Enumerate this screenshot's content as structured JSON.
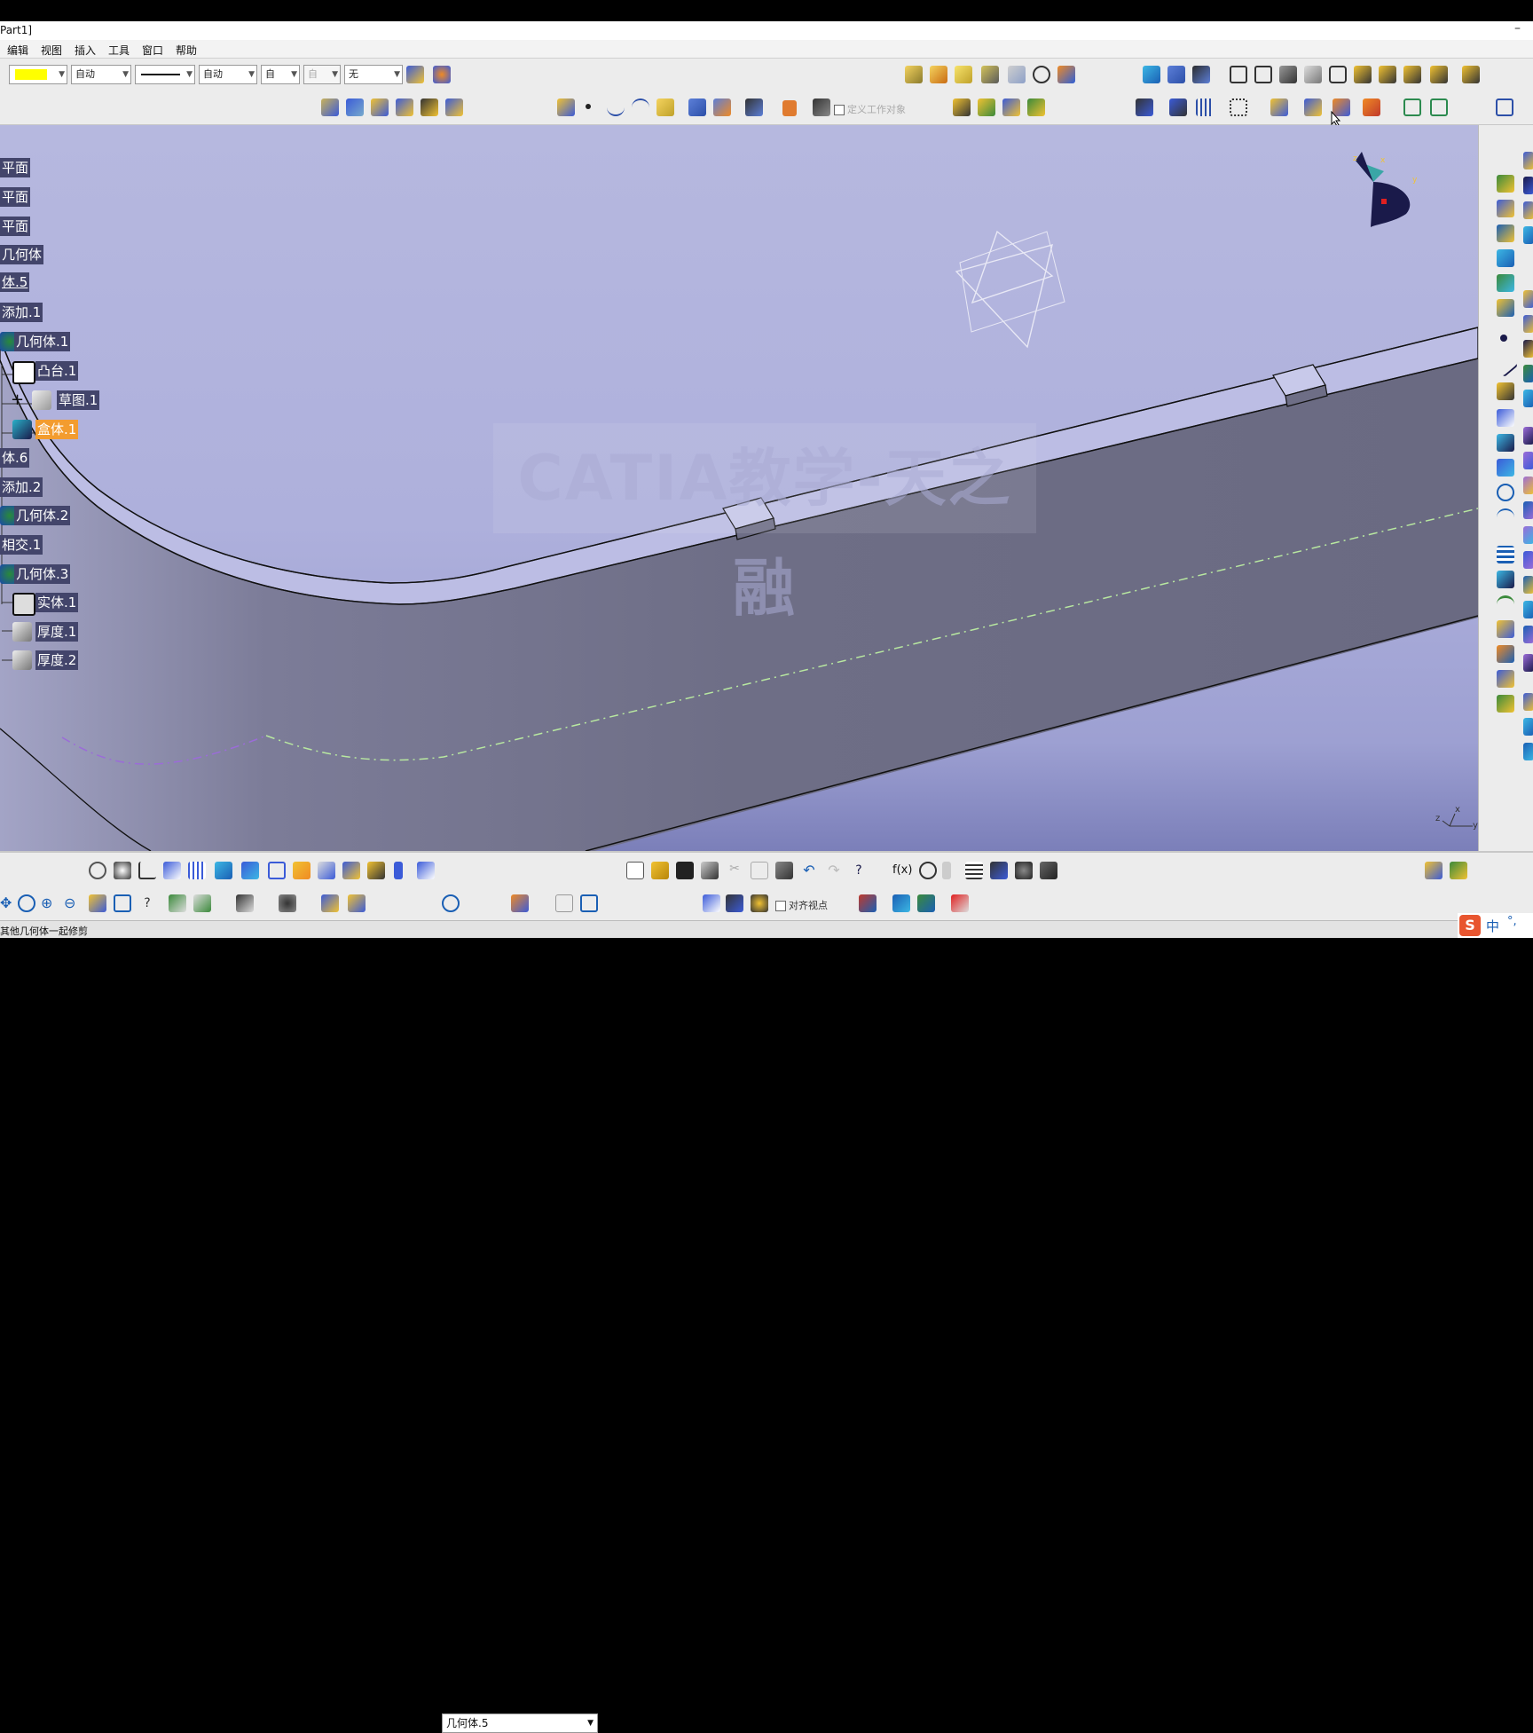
{
  "window": {
    "title": "Part1]",
    "minimize_glyph": "–"
  },
  "menu": {
    "items": [
      "编辑",
      "视图",
      "插入",
      "工具",
      "窗口",
      "帮助"
    ]
  },
  "graphic_properties": {
    "color_swatch": "#ffff00",
    "transparency": "自动",
    "line_thickness": "自动",
    "line_type": "自",
    "point_type": "自",
    "layer": "无"
  },
  "toolbar2": {
    "define_work_object_label": "定义工作对象"
  },
  "tree": {
    "nodes": [
      {
        "label": "平面",
        "icon": null,
        "selected": false
      },
      {
        "label": "平面",
        "icon": null,
        "selected": false
      },
      {
        "label": "平面",
        "icon": null,
        "selected": false
      },
      {
        "label": "几何体",
        "icon": null,
        "selected": false
      },
      {
        "label": "体.5",
        "icon": null,
        "selected": false
      },
      {
        "label": "添加.1",
        "icon": null,
        "selected": false
      },
      {
        "label": "几何体.1",
        "icon": "body-icon",
        "selected": false
      },
      {
        "label": "凸台.1",
        "icon": "pad-icon",
        "selected": false
      },
      {
        "label": "草图.1",
        "icon": "sketch-icon",
        "selected": false
      },
      {
        "label": "盒体.1",
        "icon": "shell-icon",
        "selected": true
      },
      {
        "label": "体.6",
        "icon": null,
        "selected": false
      },
      {
        "label": "添加.2",
        "icon": null,
        "selected": false
      },
      {
        "label": "几何体.2",
        "icon": "body-icon",
        "selected": false
      },
      {
        "label": "相交.1",
        "icon": null,
        "selected": false
      },
      {
        "label": "几何体.3",
        "icon": "body-icon",
        "selected": false
      },
      {
        "label": "实体.1",
        "icon": "solid-icon",
        "selected": false
      },
      {
        "label": "厚度.1",
        "icon": "thickness-icon",
        "selected": false
      },
      {
        "label": "厚度.2",
        "icon": "thickness-icon",
        "selected": false
      }
    ]
  },
  "viewport": {
    "watermark": "CATIA教学-天之融",
    "compass_axes": [
      "z",
      "x",
      "y"
    ],
    "axis_triad_labels": [
      "z",
      "x",
      "y"
    ]
  },
  "bottom_toolbar": {
    "current_body": "几何体.5",
    "align_view_label": "对齐视点",
    "formula_label": "f(x)"
  },
  "status": {
    "text": "其他几何体一起修剪"
  },
  "ime": {
    "logo": "S",
    "lang": "中",
    "punct": "°,"
  },
  "colors": {
    "tree_label_bg": "#43456b",
    "selected_node_bg": "#f39c2f",
    "viewport_bg": "#b3b5dd",
    "part_top": "#b8bae2",
    "part_side": "#6e6e86",
    "green_axis": "#b8e8a0",
    "purple_axis": "#9b6cd8"
  }
}
